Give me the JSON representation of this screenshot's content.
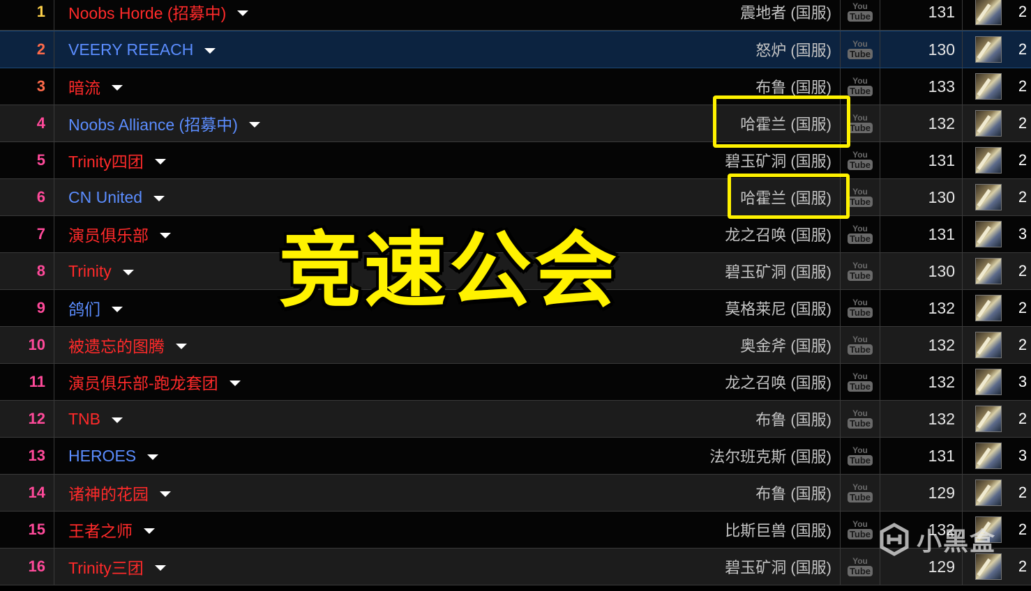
{
  "overlay_title": "竞速公会",
  "watermark": {
    "text": "小黑盒",
    "icon": "heybox-logo-icon"
  },
  "youtube_icon": {
    "you": "You",
    "tube": "Tube"
  },
  "rows": [
    {
      "rank": "1",
      "name": "Noobs Horde (招募中)",
      "faction": "horde",
      "server": "震地者 (国服)",
      "score": "131",
      "count": "2"
    },
    {
      "rank": "2",
      "name": "VEERY REEACH",
      "faction": "alliance",
      "server": "怒炉 (国服)",
      "score": "130",
      "count": "2"
    },
    {
      "rank": "3",
      "name": "暗流",
      "faction": "horde",
      "server": "布鲁 (国服)",
      "score": "133",
      "count": "2"
    },
    {
      "rank": "4",
      "name": "Noobs Alliance (招募中)",
      "faction": "alliance",
      "server": "哈霍兰 (国服)",
      "score": "132",
      "count": "2"
    },
    {
      "rank": "5",
      "name": "Trinity四团",
      "faction": "horde",
      "server": "碧玉矿洞 (国服)",
      "score": "131",
      "count": "2"
    },
    {
      "rank": "6",
      "name": "CN United",
      "faction": "alliance",
      "server": "哈霍兰 (国服)",
      "score": "130",
      "count": "2"
    },
    {
      "rank": "7",
      "name": "演员俱乐部",
      "faction": "horde",
      "server": "龙之召唤 (国服)",
      "score": "131",
      "count": "3"
    },
    {
      "rank": "8",
      "name": "Trinity",
      "faction": "horde",
      "server": "碧玉矿洞 (国服)",
      "score": "130",
      "count": "2"
    },
    {
      "rank": "9",
      "name": "鸽们",
      "faction": "alliance",
      "server": "莫格莱尼 (国服)",
      "score": "132",
      "count": "2"
    },
    {
      "rank": "10",
      "name": "被遗忘的图腾",
      "faction": "horde",
      "server": "奥金斧 (国服)",
      "score": "132",
      "count": "2"
    },
    {
      "rank": "11",
      "name": "演员俱乐部-跑龙套团",
      "faction": "horde",
      "server": "龙之召唤 (国服)",
      "score": "132",
      "count": "3"
    },
    {
      "rank": "12",
      "name": "TNB",
      "faction": "horde",
      "server": "布鲁 (国服)",
      "score": "132",
      "count": "2"
    },
    {
      "rank": "13",
      "name": "HEROES",
      "faction": "alliance",
      "server": "法尔班克斯 (国服)",
      "score": "131",
      "count": "3"
    },
    {
      "rank": "14",
      "name": "诸神的花园",
      "faction": "horde",
      "server": "布鲁 (国服)",
      "score": "129",
      "count": "2"
    },
    {
      "rank": "15",
      "name": "王者之师",
      "faction": "horde",
      "server": "比斯巨兽 (国服)",
      "score": "132",
      "count": "2"
    },
    {
      "rank": "16",
      "name": "Trinity三团",
      "faction": "horde",
      "server": "碧玉矿洞 (国服)",
      "score": "129",
      "count": "2"
    }
  ],
  "colors": {
    "rank": [
      "#ffd24a",
      "#ff7a3a",
      "#ff5a5a",
      "#ff5a8a",
      "#ff4aa0"
    ],
    "horde": "#ff2a2a",
    "alliance": "#5b8dff",
    "highlight": "#fff200"
  }
}
